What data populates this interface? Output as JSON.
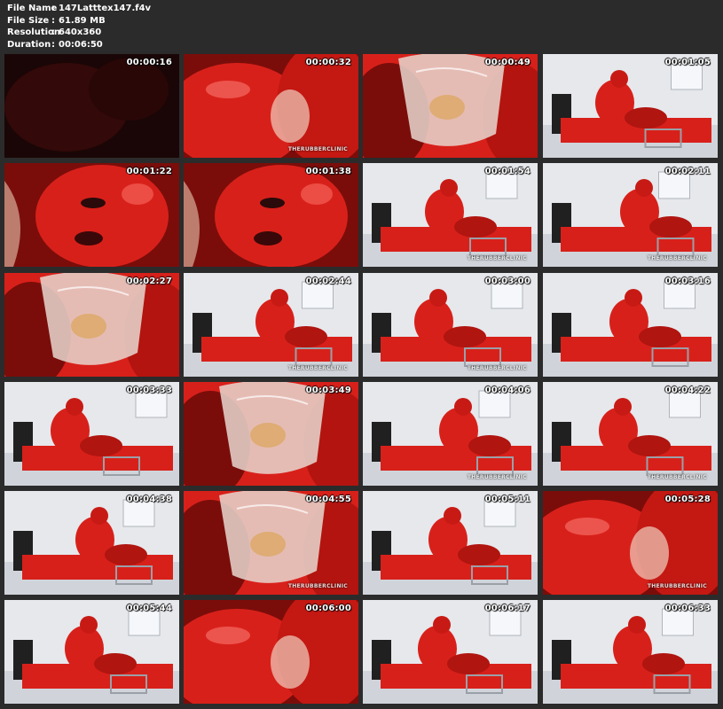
{
  "meta": {
    "file_name_label": "File Name",
    "file_name": "147Latttex147.f4v",
    "file_size_label": "File Size",
    "file_size": "61.89 MB",
    "resolution_label": "Resolution",
    "resolution": "640x360",
    "duration_label": "Duration",
    "duration": "00:06:50",
    "separator": ":"
  },
  "thumbnails": [
    {
      "time": "00:00:16",
      "scene": "dark",
      "watermark": ""
    },
    {
      "time": "00:00:32",
      "scene": "closeup",
      "watermark": "THERUBBERCLINIC"
    },
    {
      "time": "00:00:49",
      "scene": "clear",
      "watermark": ""
    },
    {
      "time": "00:01:05",
      "scene": "room",
      "watermark": ""
    },
    {
      "time": "00:01:22",
      "scene": "face",
      "watermark": ""
    },
    {
      "time": "00:01:38",
      "scene": "face",
      "watermark": ""
    },
    {
      "time": "00:01:54",
      "scene": "room",
      "watermark": "THERUBBERCLINIC"
    },
    {
      "time": "00:02:11",
      "scene": "room",
      "watermark": "THERUBBERCLINIC"
    },
    {
      "time": "00:02:27",
      "scene": "clear",
      "watermark": ""
    },
    {
      "time": "00:02:44",
      "scene": "room",
      "watermark": "THERUBBERCLINIC"
    },
    {
      "time": "00:03:00",
      "scene": "room",
      "watermark": "THERUBBERCLINIC"
    },
    {
      "time": "00:03:16",
      "scene": "room",
      "watermark": ""
    },
    {
      "time": "00:03:33",
      "scene": "room",
      "watermark": ""
    },
    {
      "time": "00:03:49",
      "scene": "clear",
      "watermark": ""
    },
    {
      "time": "00:04:06",
      "scene": "room",
      "watermark": "THERUBBERCLINIC"
    },
    {
      "time": "00:04:22",
      "scene": "room",
      "watermark": "THERUBBERCLINIC"
    },
    {
      "time": "00:04:38",
      "scene": "room",
      "watermark": ""
    },
    {
      "time": "00:04:55",
      "scene": "clear",
      "watermark": "THERUBBERCLINIC"
    },
    {
      "time": "00:05:11",
      "scene": "room",
      "watermark": ""
    },
    {
      "time": "00:05:28",
      "scene": "closeup",
      "watermark": "THERUBBERCLINIC"
    },
    {
      "time": "00:05:44",
      "scene": "room",
      "watermark": ""
    },
    {
      "time": "00:06:00",
      "scene": "closeup",
      "watermark": ""
    },
    {
      "time": "00:06:17",
      "scene": "room",
      "watermark": ""
    },
    {
      "time": "00:06:33",
      "scene": "room",
      "watermark": ""
    }
  ],
  "colors": {
    "background": "#2b2b2b",
    "latex_red": "#d8201a",
    "latex_dark": "#7a0d0a",
    "room_wall": "#e6e8ec",
    "clear_plastic": "#e8d8d0"
  }
}
